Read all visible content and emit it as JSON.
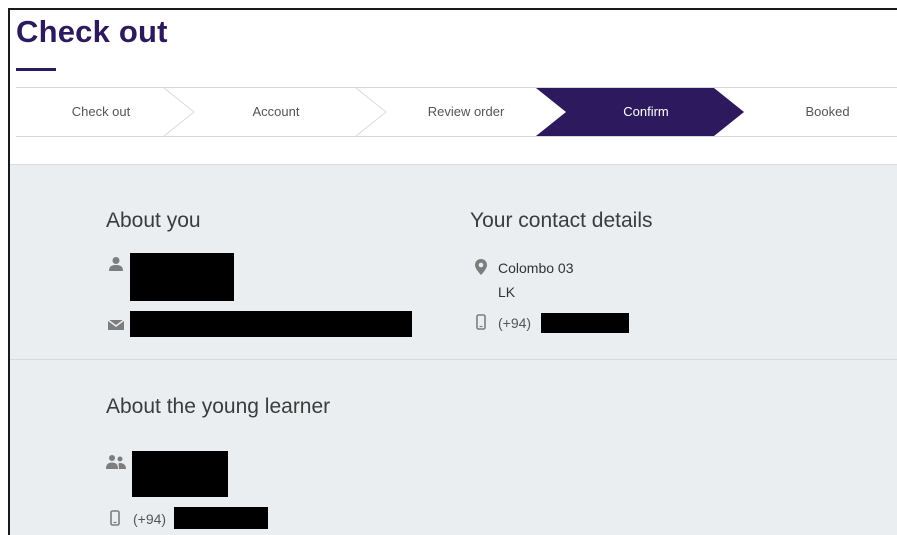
{
  "page": {
    "title": "Check out"
  },
  "stepper": {
    "steps": [
      {
        "label": "Check out",
        "active": false
      },
      {
        "label": "Account",
        "active": false
      },
      {
        "label": "Review order",
        "active": false
      },
      {
        "label": "Confirm",
        "active": true
      },
      {
        "label": "Booked",
        "active": false
      }
    ],
    "active_color": "#2d1a5e"
  },
  "about_you": {
    "heading": "About you"
  },
  "contact": {
    "heading": "Your contact details",
    "address_line1": "Colombo 03",
    "address_line2": "LK",
    "phone_prefix": "(+94)"
  },
  "learner": {
    "heading": "About the young learner",
    "phone_prefix": "(+94)"
  },
  "icons": {
    "user": "user-icon",
    "email": "envelope-icon",
    "location": "map-pin-icon",
    "phone": "mobile-phone-icon",
    "group": "users-icon"
  }
}
